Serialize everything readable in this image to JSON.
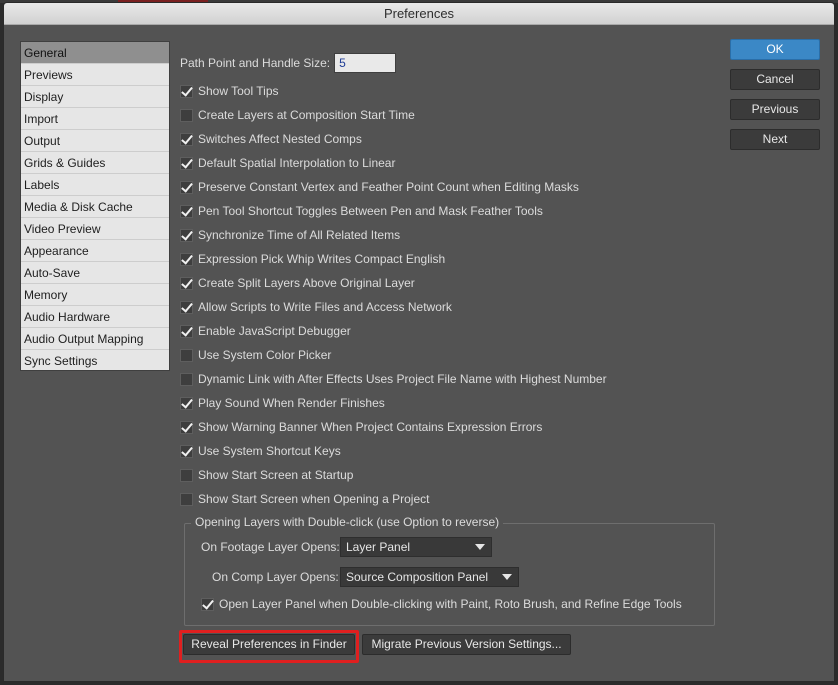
{
  "window": {
    "title": "Preferences"
  },
  "sidebar": {
    "items": [
      {
        "label": "General",
        "active": true
      },
      {
        "label": "Previews"
      },
      {
        "label": "Display"
      },
      {
        "label": "Import"
      },
      {
        "label": "Output"
      },
      {
        "label": "Grids & Guides"
      },
      {
        "label": "Labels"
      },
      {
        "label": "Media & Disk Cache"
      },
      {
        "label": "Video Preview"
      },
      {
        "label": "Appearance"
      },
      {
        "label": "Auto-Save"
      },
      {
        "label": "Memory"
      },
      {
        "label": "Audio Hardware"
      },
      {
        "label": "Audio Output Mapping"
      },
      {
        "label": "Sync Settings"
      }
    ]
  },
  "general": {
    "path_point_label": "Path Point and Handle Size:",
    "path_point_value": "5",
    "options": [
      {
        "label": "Show Tool Tips",
        "checked": true
      },
      {
        "label": "Create Layers at Composition Start Time",
        "checked": false
      },
      {
        "label": "Switches Affect Nested Comps",
        "checked": true
      },
      {
        "label": "Default Spatial Interpolation to Linear",
        "checked": true
      },
      {
        "label": "Preserve Constant Vertex and Feather Point Count when Editing Masks",
        "checked": true
      },
      {
        "label": "Pen Tool Shortcut Toggles Between Pen and Mask Feather Tools",
        "checked": true
      },
      {
        "label": "Synchronize Time of All Related Items",
        "checked": true
      },
      {
        "label": "Expression Pick Whip Writes Compact English",
        "checked": true
      },
      {
        "label": "Create Split Layers Above Original Layer",
        "checked": true
      },
      {
        "label": "Allow Scripts to Write Files and Access Network",
        "checked": true
      },
      {
        "label": "Enable JavaScript Debugger",
        "checked": true
      },
      {
        "label": "Use System Color Picker",
        "checked": false
      },
      {
        "label": "Dynamic Link with After Effects Uses Project File Name with Highest Number",
        "checked": false
      },
      {
        "label": "Play Sound When Render Finishes",
        "checked": true
      },
      {
        "label": "Show Warning Banner When Project Contains Expression Errors",
        "checked": true
      },
      {
        "label": "Use System Shortcut Keys",
        "checked": true
      },
      {
        "label": "Show Start Screen at Startup",
        "checked": false
      },
      {
        "label": "Show Start Screen when Opening a Project",
        "checked": false
      }
    ],
    "opening_group": {
      "title": "Opening Layers with Double-click (use Option to reverse)",
      "footage_label": "On Footage Layer Opens:",
      "footage_value": "Layer Panel",
      "comp_label": "On Comp Layer Opens:",
      "comp_value": "Source Composition Panel",
      "open_layer_panel_label": "Open Layer Panel when Double-clicking with Paint, Roto Brush, and Refine Edge Tools",
      "open_layer_panel_checked": true
    },
    "reveal_button": "Reveal Preferences in Finder",
    "migrate_button": "Migrate Previous Version Settings..."
  },
  "buttons": {
    "ok": "OK",
    "cancel": "Cancel",
    "previous": "Previous",
    "next": "Next"
  },
  "colors": {
    "accent": "#3b88c6",
    "highlight": "#e01f1f"
  }
}
